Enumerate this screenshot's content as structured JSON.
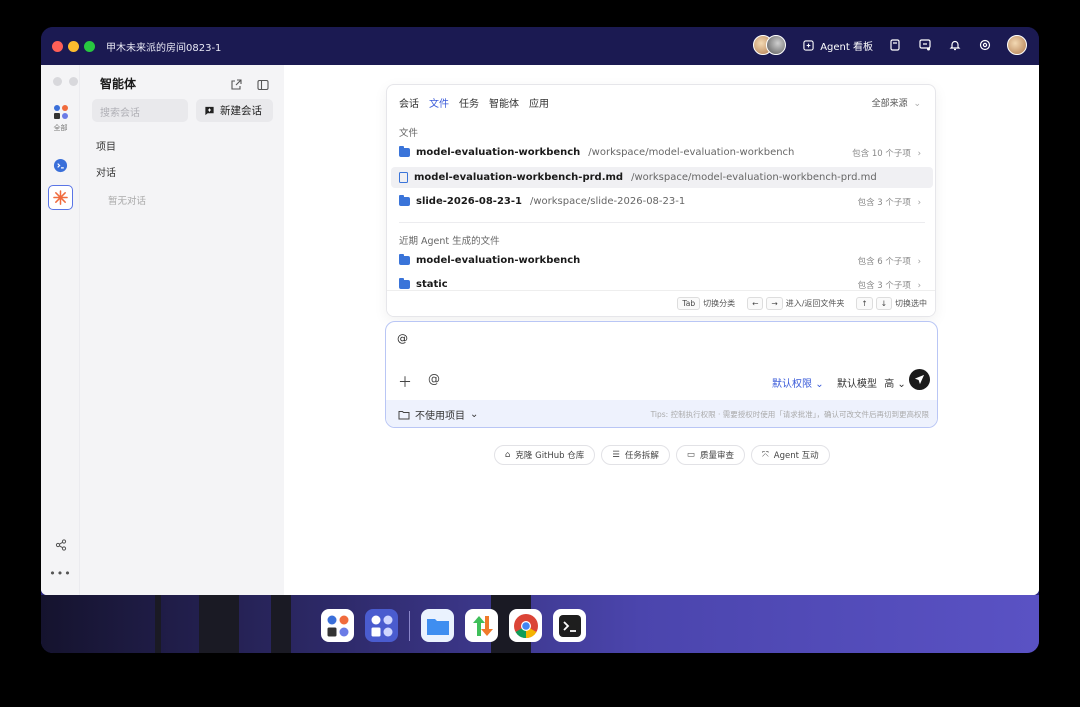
{
  "window": {
    "title": "甲木未来派的房间0823-1",
    "agent_board": "Agent 看板"
  },
  "sidebar": {
    "title": "智能体",
    "rail_all": "全部",
    "search_placeholder": "搜索会话",
    "new_chat": "新建会话",
    "section_projects": "项目",
    "section_chats": "对话",
    "empty_chats": "暂无对话"
  },
  "popup": {
    "tabs": [
      "会话",
      "文件",
      "任务",
      "智能体",
      "应用"
    ],
    "active_tab": "文件",
    "source_filter": "全部来源",
    "files_label": "文件",
    "files": [
      {
        "name": "model-evaluation-workbench",
        "path": "/workspace/model-evaluation-workbench",
        "count": "包含 10 个子项",
        "type": "folder"
      },
      {
        "name": "model-evaluation-workbench-prd.md",
        "path": "/workspace/model-evaluation-workbench-prd.md",
        "count": "",
        "type": "doc"
      },
      {
        "name": "slide-2026-08-23-1",
        "path": "/workspace/slide-2026-08-23-1",
        "count": "包含 3 个子项",
        "type": "folder"
      }
    ],
    "recent_label": "近期 Agent 生成的文件",
    "recent": [
      {
        "name": "model-evaluation-workbench",
        "count": "包含 6 个子项"
      },
      {
        "name": "static",
        "count": "包含 3 个子项"
      }
    ],
    "hints": {
      "tab_key": "Tab",
      "tab_text": "切换分类",
      "lr_text": "进入/返回文件夹",
      "ud_text": "切换选中"
    }
  },
  "composer": {
    "input_value": "@",
    "permission": "默认权限",
    "model": "默认模型",
    "level": "高",
    "project": "不使用项目",
    "tips": "Tips: 控制执行权限 · 需要授权时使用「请求批准」，确认可改文件后再切到更高权限"
  },
  "chips": [
    "克隆 GitHub 仓库",
    "任务拆解",
    "质量审查",
    "Agent 互动"
  ],
  "colors": {
    "accent": "#3a5bd9",
    "titlebar": "#1b1a52",
    "folder": "#3a74d9"
  }
}
